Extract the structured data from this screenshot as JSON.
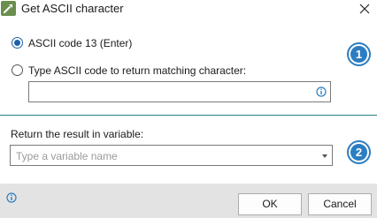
{
  "window": {
    "title": "Get ASCII character",
    "icon": "action-tool-icon",
    "close_icon": "close-icon"
  },
  "options": {
    "ascii13_label": "ASCII code 13 (Enter)",
    "ascii13_selected": true,
    "custom_label": "Type ASCII code to return matching character:",
    "custom_selected": false,
    "custom_value": ""
  },
  "result": {
    "label": "Return the result in variable:",
    "placeholder": "Type a variable name"
  },
  "badges": {
    "first": "1",
    "second": "2"
  },
  "footer": {
    "ok_label": "OK",
    "cancel_label": "Cancel"
  },
  "colors": {
    "accent": "#2c7dc1",
    "divider": "#2a7f7f",
    "footer_bg": "#e3e3e3"
  }
}
